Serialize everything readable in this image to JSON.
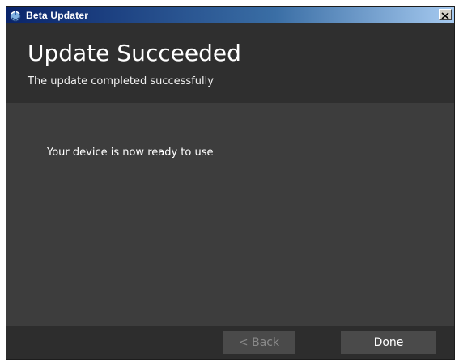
{
  "window": {
    "title": "Beta Updater",
    "icons": {
      "app": "app-updater-icon",
      "close": "close-icon"
    }
  },
  "header": {
    "title": "Update Succeeded",
    "subtitle": "The update completed successfully"
  },
  "content": {
    "message": "Your device is now ready to use"
  },
  "footer": {
    "back_label": "< Back",
    "done_label": "Done",
    "back_enabled": false
  },
  "colors": {
    "header_bg": "#2f2f2f",
    "content_bg": "#3d3d3d",
    "footer_bg": "#2d2d2d",
    "button_bg": "#4a4a4a",
    "disabled_text": "#8a8a8a",
    "text": "#ffffff"
  }
}
